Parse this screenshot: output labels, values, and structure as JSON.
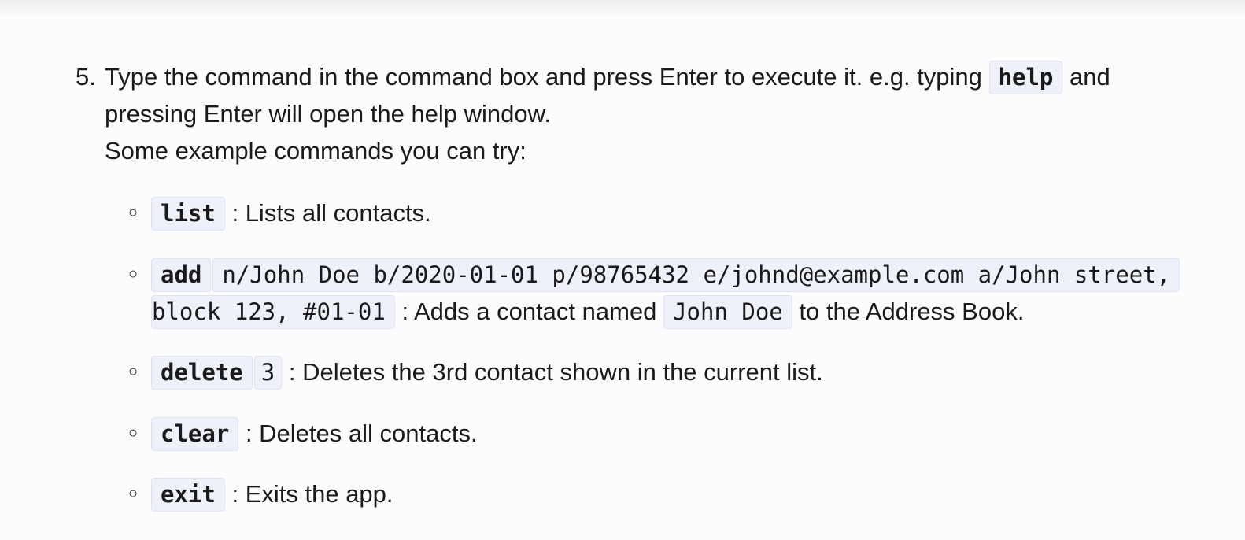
{
  "step": {
    "number": "5.",
    "line1_pre": "Type the command in the command box and press Enter to execute it. e.g. typing",
    "line1_code": "help",
    "line1_post": "and",
    "line2": "pressing Enter will open the help window.",
    "line3": "Some example commands you can try:"
  },
  "bullet_marker": "○",
  "commands": {
    "list": {
      "code": "list",
      "desc": ": Lists all contacts."
    },
    "add": {
      "code": "add",
      "args_line1": "n/John Doe b/2020-01-01 p/98765432 e/johnd@example.com a/John street,",
      "args_line2": "block 123, #01-01",
      "desc_pre": ": Adds a contact named",
      "name_code": "John Doe",
      "desc_post": "to the Address Book."
    },
    "delete": {
      "code": "delete",
      "arg": "3",
      "desc": ": Deletes the 3rd contact shown in the current list."
    },
    "clear": {
      "code": "clear",
      "desc": ": Deletes all contacts."
    },
    "exit": {
      "code": "exit",
      "desc": ": Exits the app."
    }
  }
}
